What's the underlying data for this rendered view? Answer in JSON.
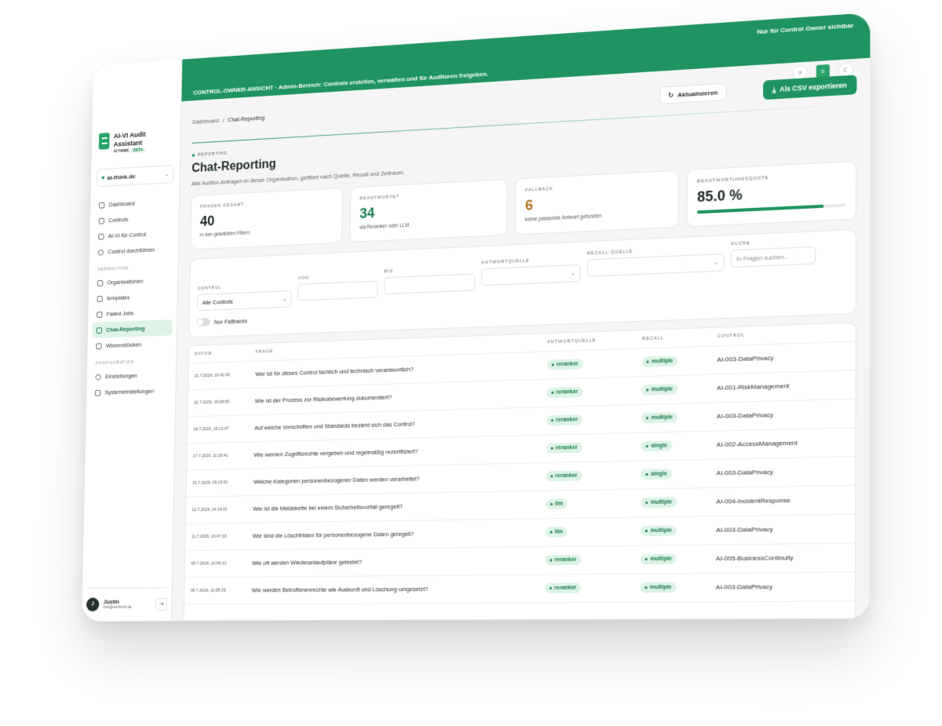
{
  "brand": {
    "title": "AI-VI Audit Assistant",
    "subtitle": "AI-THINK.",
    "badge": "BETA"
  },
  "org": {
    "name": "ai-think.de"
  },
  "nav": {
    "main": [
      "Dashboard",
      "Controls",
      "AI-VI für Control",
      "Control durchführen"
    ],
    "section_admin": "VERWALTUNG",
    "admin": [
      "Organisationen",
      "templates",
      "Failed Jobs",
      "Chat-Reporting",
      "Wissenslücken"
    ],
    "section_config": "KONFIGURATION",
    "config": [
      "Einstellungen",
      "Systemeinstellungen"
    ],
    "active": "Chat-Reporting"
  },
  "user": {
    "initial": "J",
    "name": "Justin",
    "email": "info@ai-think.de"
  },
  "banner": {
    "message": "CONTROL-OWNER-ANSICHT · Admin-Bereich: Controls erstellen, verwalten und für Auditoren freigeben.",
    "owner_note": "Nur für Control Owner sichtbar"
  },
  "breadcrumb": {
    "root": "Dashboard",
    "sep": "/",
    "current": "Chat-Reporting"
  },
  "actions": {
    "refresh": "Aktualisieren",
    "export": "Als CSV exportieren"
  },
  "page": {
    "eyebrow": "REPORTING",
    "title": "Chat-Reporting",
    "subtitle": "Alle Auditor-Anfragen in dieser Organisation, gefiltert nach Quelle, Recall und Zeitraum."
  },
  "stats": {
    "total": {
      "label": "FRAGEN GESAMT",
      "value": "40",
      "note": "in den gewählten Filtern"
    },
    "answered": {
      "label": "BEANTWORTET",
      "value": "34",
      "note": "via Reranker oder LLM"
    },
    "fallback": {
      "label": "FALLBACK",
      "value": "6",
      "note": "keine passende Antwort gefunden"
    },
    "rate": {
      "label": "BEANTWORTUNGSQUOTE",
      "value": "85.0 %",
      "fraction": 0.85
    }
  },
  "filters": {
    "control_label": "CONTROL",
    "control_value": "Alle Controls",
    "von_label": "VON",
    "bis_label": "BIS",
    "source_label": "ANTWORTQUELLE",
    "recall_label": "RECALL-QUELLE",
    "search_label": "SUCHE",
    "search_placeholder": "In Fragen suchen...",
    "fallback_toggle": "Nur Fallbacks"
  },
  "table": {
    "headers": [
      "DATUM",
      "FRAGE",
      "ANTWORTQUELLE",
      "RECALL",
      "CONTROL"
    ],
    "rows": [
      {
        "date": "21.7.2026, 10:42:18",
        "question": "Wer ist für dieses Control fachlich und technisch verantwortlich?",
        "source": "reranker",
        "recall": "multiple",
        "control": "AI-003-DataPrivacy"
      },
      {
        "date": "20.7.2026, 16:08:55",
        "question": "Wie ist der Prozess zur Risikobewertung dokumentiert?",
        "source": "reranker",
        "recall": "multiple",
        "control": "AI-001-RiskManagement"
      },
      {
        "date": "18.7.2026, 15:12:07",
        "question": "Auf welche Vorschriften und Standards bezieht sich das Control?",
        "source": "reranker",
        "recall": "multiple",
        "control": "AI-003-DataPrivacy"
      },
      {
        "date": "17.7.2026, 11:33:41",
        "question": "Wie werden Zugriffsrechte vergeben und regelmäßig rezertifiziert?",
        "source": "reranker",
        "recall": "single",
        "control": "AI-002-AccessManagement"
      },
      {
        "date": "15.7.2026, 09:23:51",
        "question": "Welche Kategorien personenbezogener Daten werden verarbeitet?",
        "source": "reranker",
        "recall": "single",
        "control": "AI-003-DataPrivacy"
      },
      {
        "date": "12.7.2026, 14:19:02",
        "question": "Wie ist die Meldekette bei einem Sicherheitsvorfall geregelt?",
        "source": "llm",
        "recall": "multiple",
        "control": "AI-004-IncidentResponse"
      },
      {
        "date": "11.7.2026, 16:47:33",
        "question": "Wie sind die Löschfristen für personenbezogene Daten geregelt?",
        "source": "llm",
        "recall": "multiple",
        "control": "AI-003-DataPrivacy"
      },
      {
        "date": "09.7.2026, 10:05:12",
        "question": "Wie oft werden Wiederanlaufpläne getestet?",
        "source": "reranker",
        "recall": "multiple",
        "control": "AI-005-BusinessContinuity"
      },
      {
        "date": "08.7.2026, 11:05:29",
        "question": "Wie werden Betroffenenrechte wie Auskunft und Löschung umgesetzt?",
        "source": "reranker",
        "recall": "multiple",
        "control": "AI-003-DataPrivacy"
      }
    ]
  },
  "colors": {
    "accent": "#1f9460",
    "pill_bg": "#ddf3e6",
    "fallback": "#a86e1a"
  }
}
